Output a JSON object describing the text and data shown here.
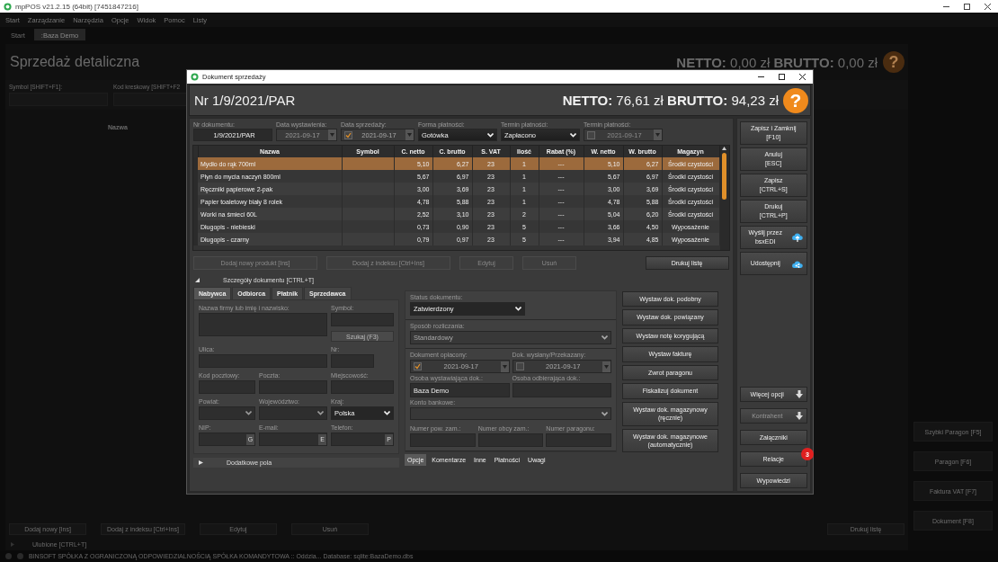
{
  "app": {
    "title": "mpPOS v21.2.15 (64bit) [7451847216]",
    "menu": [
      "Start",
      "Zarządzanie",
      "Narzędzia",
      "Opcje",
      "Widok",
      "Pomoc",
      "Listy"
    ],
    "tabs": [
      {
        "label": "Start",
        "selected": false
      },
      {
        "label": ":Baza Demo",
        "selected": true
      }
    ],
    "heading": "Sprzedaż detaliczna",
    "totals": "**NETTO:** 0,00 zł **BRUTTO:** 0,00 zł",
    "help": "?",
    "filters": [
      "Symbol [SHIFT+F1]:",
      "Kod kreskowy [SHIFT+F2"
    ],
    "column": "Nazwa",
    "side_buttons": [
      "Szybki Paragon [F5]",
      "Paragon [F6]",
      "Faktura VAT [F7]",
      "Dokument [F8]"
    ],
    "bottom_buttons": [
      "Dodaj nowy [Ins]",
      "Dodaj z indeksu [Ctrl+Ins]",
      "Edytuj",
      "Usuń",
      "Drukuj listę"
    ],
    "favorites": "Ulubione [CTRL+T]",
    "status": "BINSOFT SPÓŁKA Z OGRANICZONĄ ODPOWIEDZIALNOŚCIĄ SPÓŁKA KOMANDYTOWA :: Oddzia... Database: sqlite:BazaDemo.dbs"
  },
  "dialog": {
    "title": "Dokument sprzedaży",
    "number": "Nr 1/9/2021/PAR",
    "totals": "**NETTO:** 76,61 zł **BRUTTO:** 94,23 zł",
    "help": "?",
    "fields": [
      {
        "label": "Nr dokumentu:",
        "value": "1/9/2021/PAR",
        "kind": "text"
      },
      {
        "label": "Data wystawienia:",
        "value": "2021-09-17",
        "kind": "date"
      },
      {
        "label": "Data sprzedaży:",
        "value": "2021-09-17",
        "kind": "checkdate",
        "checked": true
      },
      {
        "label": "Forma płatności:",
        "value": "Gotówka",
        "kind": "select"
      },
      {
        "label": "Termin płatności:",
        "value": "Zapłacono",
        "kind": "select"
      },
      {
        "label": "Termin płatności:",
        "value": "2021-09-17",
        "kind": "checkdate",
        "checked": false
      }
    ],
    "table": {
      "columns": [
        "Nazwa",
        "Symbol",
        "C. netto",
        "C. brutto",
        "S. VAT",
        "Ilość",
        "Rabat (%)",
        "W. netto",
        "W. brutto",
        "Magazyn"
      ],
      "rows": [
        {
          "cells": [
            "Mydło do rąk 700ml",
            "",
            "5,10",
            "6,27",
            "23",
            "1",
            "---",
            "5,10",
            "6,27",
            "Środki czystości"
          ],
          "selected": true
        },
        {
          "cells": [
            "Płyn do mycia naczyń 800ml",
            "",
            "5,67",
            "6,97",
            "23",
            "1",
            "---",
            "5,67",
            "6,97",
            "Środki czystości"
          ],
          "selected": false
        },
        {
          "cells": [
            "Ręczniki papierowe 2-pak",
            "",
            "3,00",
            "3,69",
            "23",
            "1",
            "---",
            "3,00",
            "3,69",
            "Środki czystości"
          ],
          "selected": false
        },
        {
          "cells": [
            "Papier toaletowy biały 8 rolek",
            "",
            "4,78",
            "5,88",
            "23",
            "1",
            "---",
            "4,78",
            "5,88",
            "Środki czystości"
          ],
          "selected": false
        },
        {
          "cells": [
            "Worki na śmieci 60L",
            "",
            "2,52",
            "3,10",
            "23",
            "2",
            "---",
            "5,04",
            "6,20",
            "Środki czystości"
          ],
          "selected": false
        },
        {
          "cells": [
            "Długopis - niebieski",
            "",
            "0,73",
            "0,90",
            "23",
            "5",
            "---",
            "3,66",
            "4,50",
            "Wyposażenie"
          ],
          "selected": false
        },
        {
          "cells": [
            "Długopis - czarny",
            "",
            "0,79",
            "0,97",
            "23",
            "5",
            "---",
            "3,94",
            "4,85",
            "Wyposażenie"
          ],
          "selected": false
        }
      ]
    },
    "table_buttons": [
      {
        "label": "Dodaj nowy produkt [Ins]",
        "disabled": true
      },
      {
        "label": "Dodaj z indeksu [Ctrl+Ins]",
        "disabled": true
      },
      {
        "label": "Edytuj",
        "disabled": true
      },
      {
        "label": "Usuń",
        "disabled": true
      },
      {
        "label": "Drukuj listę",
        "disabled": false
      }
    ],
    "details": {
      "label": "Szczegóły dokumentu [CTRL+T]",
      "expanded": true
    },
    "party_tabs": [
      {
        "label": "Nabywca",
        "selected": true
      },
      {
        "label": "Odbiorca",
        "selected": false
      },
      {
        "label": "Płatnik",
        "selected": false
      },
      {
        "label": "Sprzedawca",
        "selected": false
      }
    ],
    "buyer_rows": [
      [
        {
          "label": "Nazwa firmy lub imię i nazwisko:",
          "kind": "multiline"
        },
        {
          "label": "Symbol:",
          "kind": "search",
          "button": "Szukaj (F3)"
        }
      ],
      [
        {
          "label": "Ulica:",
          "kind": "text"
        },
        {
          "label": "Nr:",
          "kind": "short"
        }
      ],
      [
        {
          "label": "Kod pocztowy:",
          "kind": "text"
        },
        {
          "label": "Poczta:",
          "kind": "text"
        },
        {
          "label": "Miejscowość:",
          "kind": "text"
        }
      ],
      [
        {
          "label": "Powiat:",
          "kind": "select"
        },
        {
          "label": "Województwo:",
          "kind": "select"
        },
        {
          "label": "Kraj:",
          "kind": "select",
          "value": "Polska"
        }
      ],
      [
        {
          "label": "NIP:",
          "kind": "suffix",
          "button": "G"
        },
        {
          "label": "E-mail:",
          "kind": "suffix",
          "button": "E"
        },
        {
          "label": "Telefon:",
          "kind": "suffix",
          "button": "P"
        }
      ]
    ],
    "extra_fields": {
      "label": "Dodatkowe pola",
      "expanded": false
    },
    "options": {
      "status": {
        "label": "Status dokumentu:",
        "value": "Zatwierdzony"
      },
      "settlement": {
        "label": "Sposób rozliczania:",
        "value": "Standardowy"
      },
      "paid": {
        "label": "Dokument opłacony:",
        "value": "2021-09-17",
        "checked": true
      },
      "sent": {
        "label": "Dok. wysłany/Przekazany:",
        "value": "2021-09-17",
        "checked": false
      },
      "issuer": {
        "label": "Osoba wystawiająca dok.:",
        "value": "Baza Demo"
      },
      "receiver": {
        "label": "Osoba odbierająca dok.:"
      },
      "bank_account": {
        "label": "Konto bankowe:"
      },
      "numbers": [
        "Numer pow. zam.:",
        "Numer obcy zam.:",
        "Numer paragonu:"
      ]
    },
    "option_tabs": [
      {
        "label": "Opcje",
        "selected": true
      },
      {
        "label": "Komentarze",
        "selected": false
      },
      {
        "label": "Inne",
        "selected": false
      },
      {
        "label": "Płatności",
        "selected": false
      },
      {
        "label": "Uwagi",
        "selected": false
      }
    ],
    "actions": [
      "Wystaw dok. podobny",
      "Wystaw dok. powiązany",
      "Wystaw notę korygującą",
      "Wystaw fakturę",
      "Zwrot paragonu",
      "Fiskalizuj dokument",
      "Wystaw dok. magazynowy\n(ręcznie)",
      "Wystaw dok. magazynowe\n(automatycznie)"
    ],
    "side_buttons": [
      {
        "label": "Zapisz i Zamknij\n[F10]",
        "kind": "plain"
      },
      {
        "label": "Anuluj\n[ESC]",
        "kind": "plain"
      },
      {
        "label": "Zapisz\n[CTRL+S]",
        "kind": "plain"
      },
      {
        "label": "Drukuj\n[CTRL+P]",
        "kind": "plain"
      },
      {
        "label": "Wyślij przez\nbsxEDI",
        "kind": "upload"
      },
      {
        "label": "Udostępnij",
        "kind": "share"
      }
    ],
    "side_bottom_buttons": [
      {
        "label": "Więcej opcji",
        "kind": "dropdown",
        "disabled": false
      },
      {
        "label": "Kontrahent",
        "kind": "dropdown",
        "disabled": true
      },
      {
        "label": "Załączniki",
        "kind": "plain",
        "disabled": false
      },
      {
        "label": "Relacje",
        "kind": "plain",
        "badge": "3",
        "disabled": false
      },
      {
        "label": "Wypowiedzi",
        "kind": "plain",
        "disabled": false
      }
    ]
  }
}
